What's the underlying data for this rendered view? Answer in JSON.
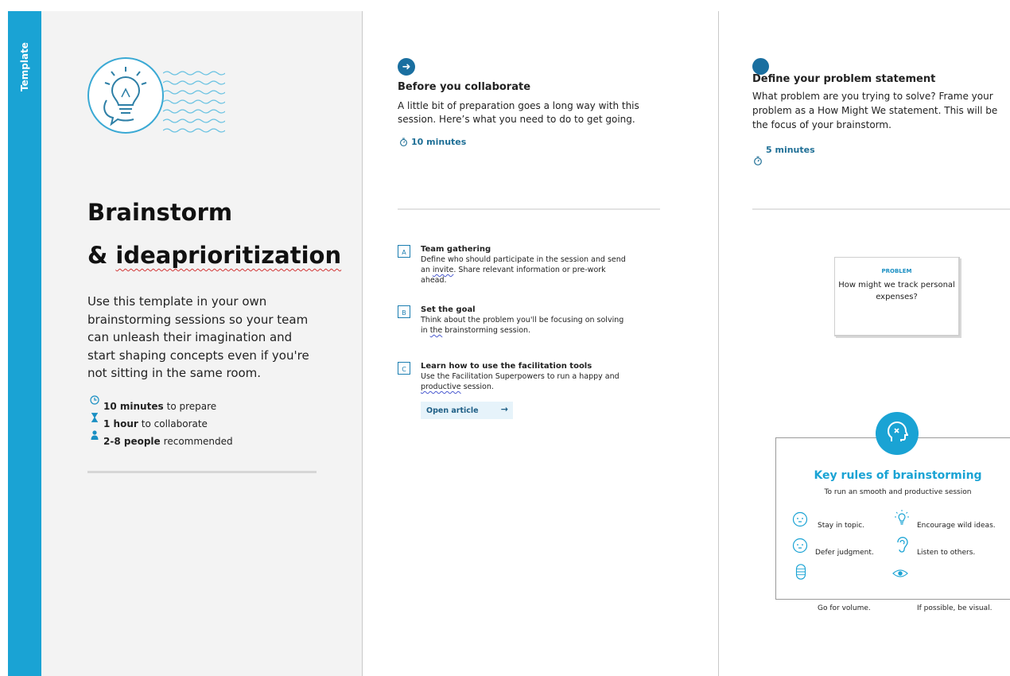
{
  "sidebar": {
    "label": "Template"
  },
  "left": {
    "title_line1": "Brainstorm",
    "title_line2_prefix": "& ",
    "title_line2_word": "ideaprioritization",
    "intro": "Use this template in your own brainstorming sessions so your team can unleash their imagination and start shaping concepts even if you're not sitting in the same room.",
    "meta": [
      {
        "icon": "clock-icon",
        "bold": "10 minutes",
        "text": "to prepare"
      },
      {
        "icon": "hourglass-icon",
        "bold": "1 hour",
        "text": "to collaborate"
      },
      {
        "icon": "person-icon",
        "bold": "2-8 people",
        "text": "recommended"
      }
    ]
  },
  "middle": {
    "step_icon": "arrow-right-icon",
    "heading": "Before you collaborate",
    "description": "A little bit of preparation goes a long way with this session. Here’s what you need to do to get going.",
    "time": "10 minutes",
    "items": [
      {
        "badge": "A",
        "title": "Team gathering",
        "desc_before": "Define who should participate in the session and send an ",
        "desc_wavy": "invite",
        "desc_after": ". Share relevant information or pre-work ahead."
      },
      {
        "badge": "B",
        "title": "Set the goal",
        "desc_before": "Think about the problem you'll be focusing on solving in ",
        "desc_wavy": "the",
        "desc_after": " brainstorming session."
      },
      {
        "badge": "C",
        "title": "Learn how to use the facilitation tools",
        "desc_before": "Use the Facilitation Superpowers to run a happy and ",
        "desc_wavy": "productive",
        "desc_after": " session."
      }
    ],
    "button_label": "Open article",
    "button_arrow": "→"
  },
  "right": {
    "heading": "Define your problem statement",
    "description": "What problem are you trying to solve? Frame your problem as a How Might We statement. This will be the focus of your brainstorm.",
    "time": "5 minutes",
    "card": {
      "tag": "PROBLEM",
      "text": "How might we track personal expenses?"
    },
    "rules": {
      "title": "Key rules of brainstorming",
      "subtitle": "To run an smooth and productive session",
      "items": [
        {
          "icon": "face-icon",
          "text": "Stay in topic."
        },
        {
          "icon": "lightbulb-icon",
          "text": "Encourage wild ideas."
        },
        {
          "icon": "face-icon",
          "text": "Defer judgment."
        },
        {
          "icon": "ear-icon",
          "text": "Listen to others."
        },
        {
          "icon": "stack-icon",
          "text": "Go for volume."
        },
        {
          "icon": "eye-icon",
          "text": "If possible, be visual."
        }
      ]
    }
  },
  "colors": {
    "brand": "#1aa3d4",
    "dark_blue": "#1a6fa0",
    "panel": "#f3f3f3"
  }
}
